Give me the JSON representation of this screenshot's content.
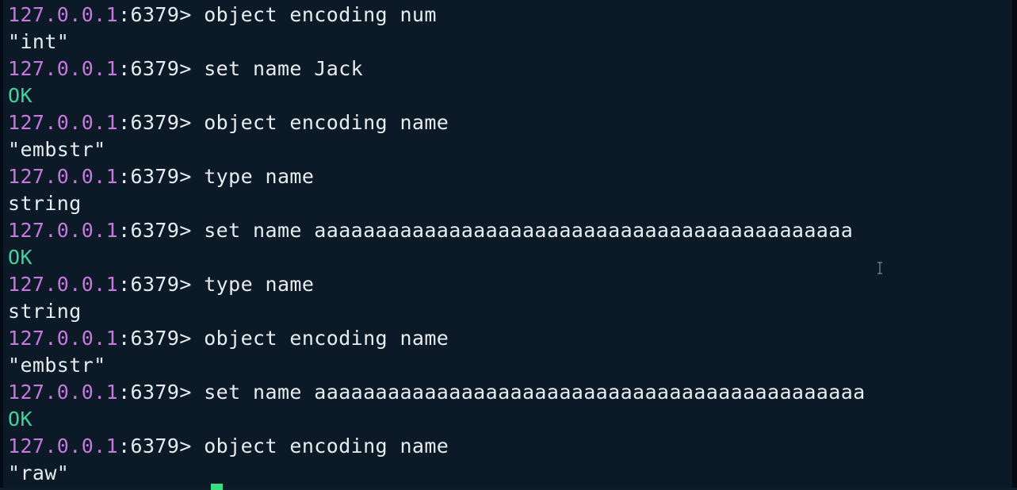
{
  "terminal": {
    "lines": [
      {
        "kind": "prompt",
        "host": "127.0.0.1",
        "port_prompt": ":6379> ",
        "command": "object encoding num"
      },
      {
        "kind": "output",
        "text": "\"int\""
      },
      {
        "kind": "prompt",
        "host": "127.0.0.1",
        "port_prompt": ":6379> ",
        "command": "set name Jack"
      },
      {
        "kind": "ok",
        "text": "OK"
      },
      {
        "kind": "prompt",
        "host": "127.0.0.1",
        "port_prompt": ":6379> ",
        "command": "object encoding name"
      },
      {
        "kind": "output",
        "text": "\"embstr\""
      },
      {
        "kind": "prompt",
        "host": "127.0.0.1",
        "port_prompt": ":6379> ",
        "command": "type name"
      },
      {
        "kind": "output",
        "text": "string"
      },
      {
        "kind": "prompt",
        "host": "127.0.0.1",
        "port_prompt": ":6379> ",
        "command": "set name aaaaaaaaaaaaaaaaaaaaaaaaaaaaaaaaaaaaaaaaaaaa"
      },
      {
        "kind": "ok",
        "text": "OK"
      },
      {
        "kind": "prompt",
        "host": "127.0.0.1",
        "port_prompt": ":6379> ",
        "command": "type name"
      },
      {
        "kind": "output",
        "text": "string"
      },
      {
        "kind": "prompt",
        "host": "127.0.0.1",
        "port_prompt": ":6379> ",
        "command": "object encoding name"
      },
      {
        "kind": "output",
        "text": "\"embstr\""
      },
      {
        "kind": "prompt",
        "host": "127.0.0.1",
        "port_prompt": ":6379> ",
        "command": "set name aaaaaaaaaaaaaaaaaaaaaaaaaaaaaaaaaaaaaaaaaaaaa"
      },
      {
        "kind": "ok",
        "text": "OK"
      },
      {
        "kind": "prompt",
        "host": "127.0.0.1",
        "port_prompt": ":6379> ",
        "command": "object encoding name"
      },
      {
        "kind": "output",
        "text": "\"raw\""
      }
    ]
  },
  "colors": {
    "background": "#0c1a28",
    "prompt_host": "#c678dd",
    "ok_text": "#42d39a",
    "default_text": "#e7ecef",
    "cursor": "#3ddc84"
  },
  "icons": {
    "mouse_pointer": "text-ibeam-cursor-icon",
    "terminal_cursor": "block-cursor-icon"
  }
}
